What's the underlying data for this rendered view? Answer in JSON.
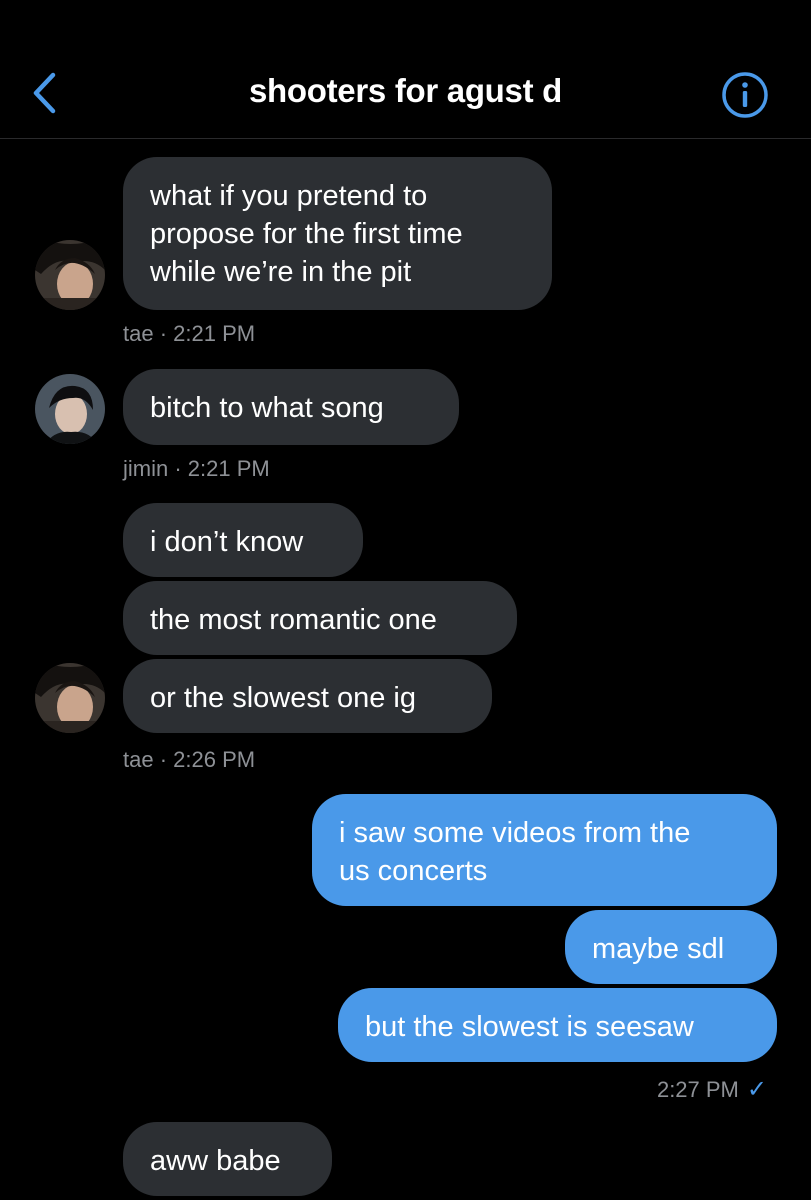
{
  "header": {
    "title": "shooters for agust d",
    "back_icon": "chevron-left-icon",
    "info_icon": "info-circle-icon",
    "accent_color": "#4a99e9"
  },
  "colors": {
    "background": "#000000",
    "incoming_bubble": "#2c2f33",
    "outgoing_bubble": "#4a99e9",
    "meta_text": "#8e9196"
  },
  "messages": {
    "m1": "what if you pretend to\npropose for the first time\nwhile we’re in the pit",
    "m1_meta": "tae · 2:21 PM",
    "m2": "bitch to what song",
    "m2_meta": "jimin · 2:21 PM",
    "m3": "i don’t know",
    "m4": "the most romantic one",
    "m5": "or the slowest one ig",
    "m5_meta": "tae · 2:26 PM",
    "m6": "i saw some videos from the\nus concerts",
    "m7": "maybe sdl",
    "m8": "but the slowest is seesaw",
    "m8_meta": "2:27 PM",
    "m8_status": "✓",
    "m9": "aww babe"
  }
}
